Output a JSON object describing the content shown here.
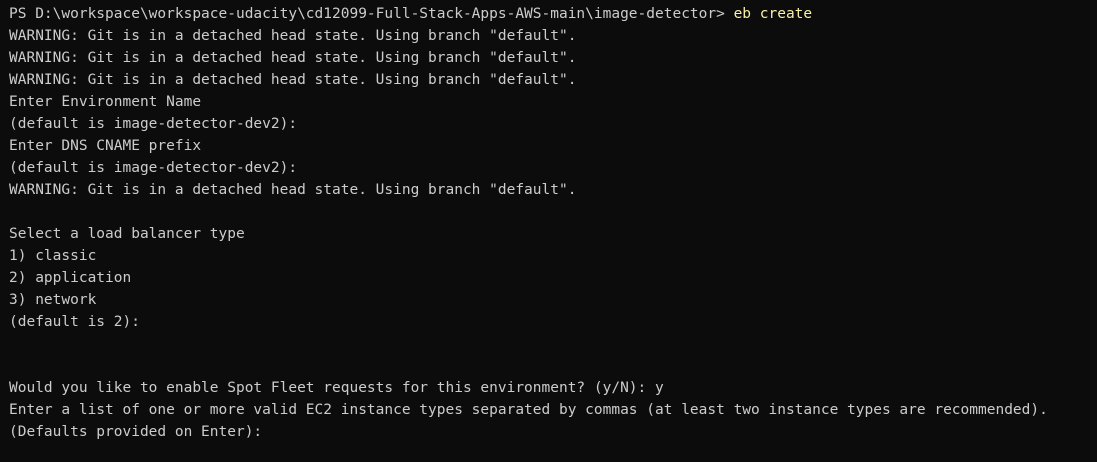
{
  "terminal": {
    "prompt": {
      "path": "PS D:\\workspace\\workspace-udacity\\cd12099-Full-Stack-Apps-AWS-main\\image-detector> ",
      "command": "eb create"
    },
    "lines": [
      "WARNING: Git is in a detached head state. Using branch \"default\".",
      "WARNING: Git is in a detached head state. Using branch \"default\".",
      "WARNING: Git is in a detached head state. Using branch \"default\".",
      "Enter Environment Name",
      "(default is image-detector-dev2):",
      "Enter DNS CNAME prefix",
      "(default is image-detector-dev2):",
      "WARNING: Git is in a detached head state. Using branch \"default\".",
      "",
      "Select a load balancer type",
      "1) classic",
      "2) application",
      "3) network",
      "(default is 2):",
      "",
      "",
      "Would you like to enable Spot Fleet requests for this environment? (y/N): y",
      "Enter a list of one or more valid EC2 instance types separated by commas (at least two instance types are recommended).",
      "(Defaults provided on Enter):"
    ]
  },
  "colors": {
    "background": "#0c0c0c",
    "text": "#cccccc",
    "command": "#f9f1a5"
  }
}
